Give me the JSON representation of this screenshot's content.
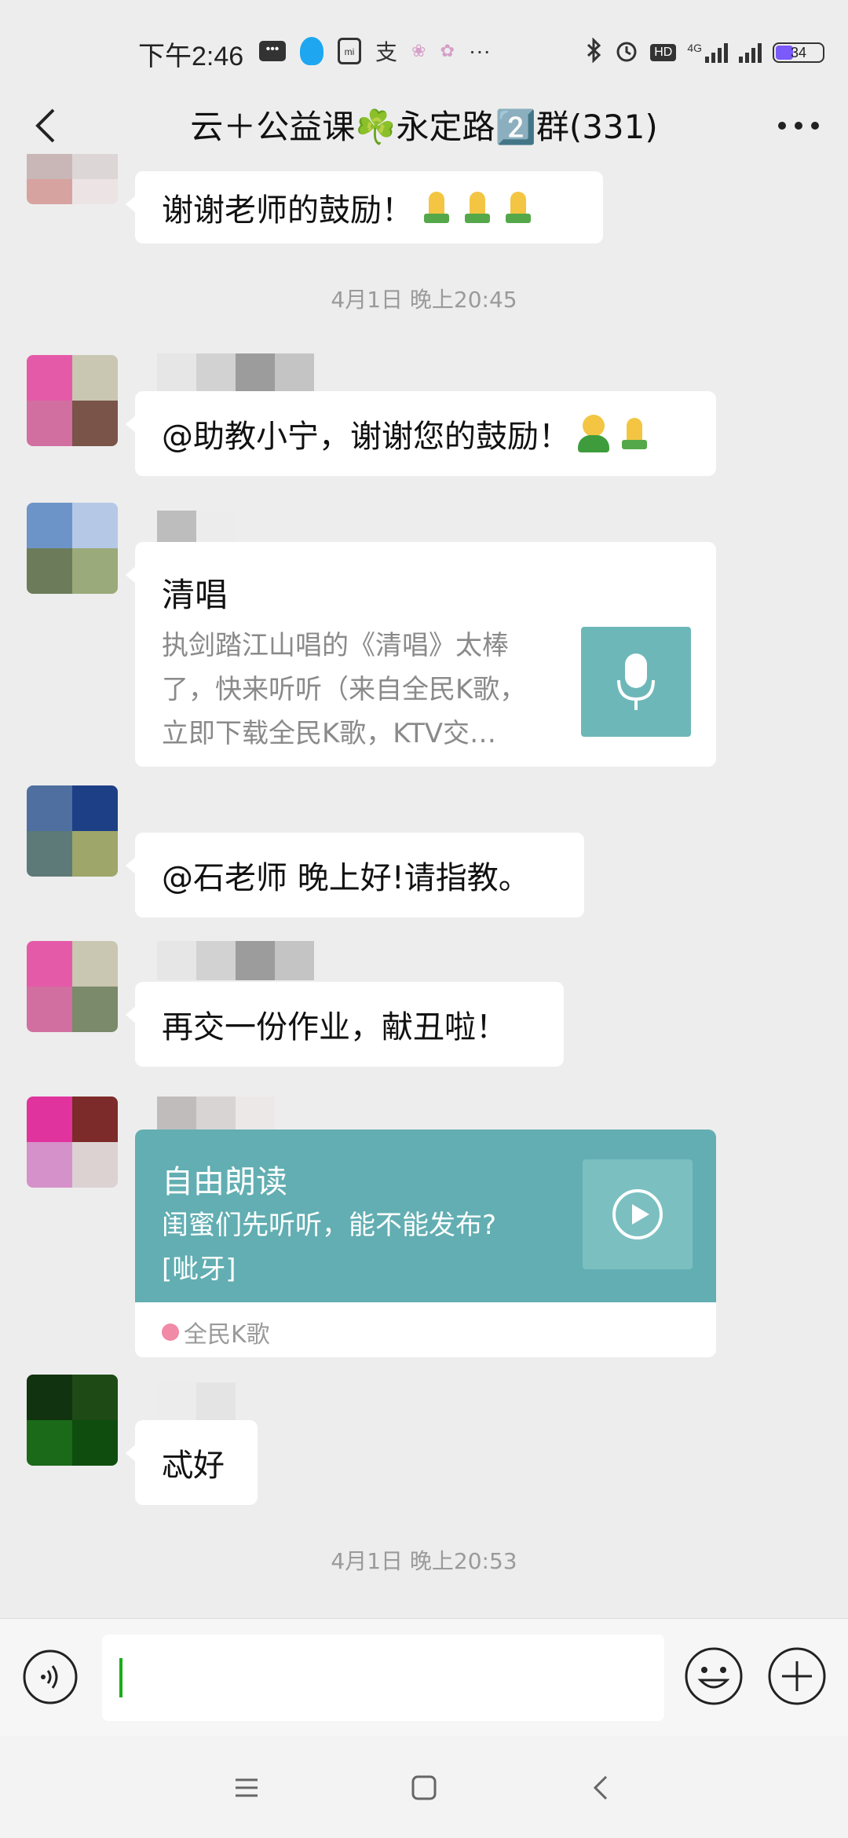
{
  "status_bar": {
    "time": "下午2:46",
    "network": "4G",
    "battery": "34",
    "hd": "HD",
    "accent_battery": "#7a5af8"
  },
  "header": {
    "title": "云＋公益课☘️永定路2️⃣群(331)"
  },
  "messages": {
    "m0_text": "谢谢老师的鼓励！",
    "time1": "4月1日 晚上20:45",
    "m1_text": "@助教小宁，谢谢您的鼓励！",
    "m2_card": {
      "title": "清唱",
      "desc_line1": "执剑踏江山唱的《清唱》太棒",
      "desc_line2": "了，快来听听（来自全民K歌，",
      "desc_line3": "立即下载全民K歌，KTV交…"
    },
    "m3_text": "@石老师  晚上好!请指教。",
    "m4_text": "再交一份作业，献丑啦！",
    "m5_card": {
      "title": "自由朗读",
      "desc_line1": "闺蜜们先听听，能不能发布?",
      "desc_line2": "[呲牙]",
      "source": "全民K歌",
      "color": "#62aeb2"
    },
    "m6_text": "忒好",
    "time2": "4月1日 晚上20:53"
  },
  "icons": {
    "back": "back-arrow-icon",
    "more": "more-icon",
    "voice": "voice-icon",
    "emoji": "emoji-icon",
    "plus": "plus-icon"
  }
}
